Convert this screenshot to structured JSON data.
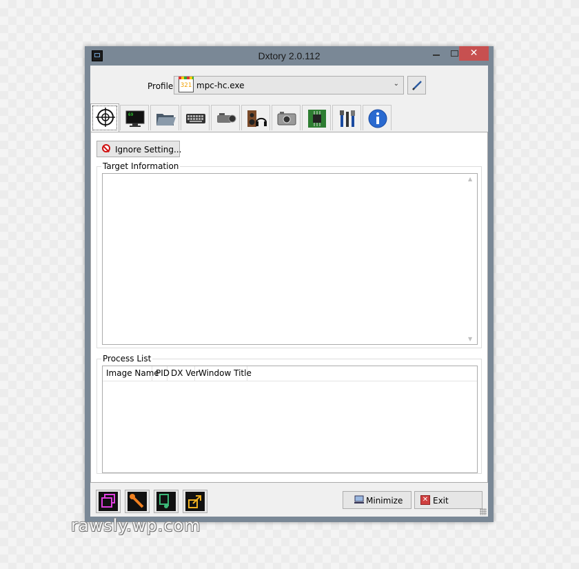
{
  "window": {
    "title": "Dxtory 2.0.112",
    "close_glyph": "✕",
    "icon": "dxtory-app-icon"
  },
  "profile": {
    "label": "Profile",
    "selected": "mpc-hc.exe",
    "selected_icon": "mpc-hc-clapper-icon",
    "edit_icon": "pencil-icon",
    "dropdown_glyph": "⌄"
  },
  "tabs": [
    {
      "name": "target",
      "icon": "crosshair-icon",
      "active": true
    },
    {
      "name": "overlay",
      "icon": "monitor-icon",
      "active": false
    },
    {
      "name": "folder",
      "icon": "folder-icon",
      "active": false
    },
    {
      "name": "hotkey",
      "icon": "keyboard-icon",
      "active": false
    },
    {
      "name": "movie",
      "icon": "video-camera-icon",
      "active": false
    },
    {
      "name": "audio",
      "icon": "speaker-headphones-icon",
      "active": false
    },
    {
      "name": "screenshot",
      "icon": "camera-icon",
      "active": false
    },
    {
      "name": "advanced",
      "icon": "chip-icon",
      "active": false
    },
    {
      "name": "tools",
      "icon": "tools-icon",
      "active": false
    },
    {
      "name": "info",
      "icon": "info-icon",
      "active": false
    }
  ],
  "target": {
    "ignore_button": "Ignore Setting...",
    "target_info_label": "Target Information",
    "process_list_label": "Process List",
    "columns": [
      "Image Name",
      "PID",
      "DX Ver",
      "Window Title"
    ]
  },
  "bottom": {
    "minimize_label": "Minimize",
    "exit_label": "Exit",
    "exit_glyph": "✕",
    "tool_icons": [
      "windows-stack-icon",
      "wrench-icon",
      "audio-file-icon",
      "export-icon"
    ]
  },
  "watermark": "rawsly.wp.com",
  "colors": {
    "titlebar": "#7a8896",
    "close_button": "#c75050",
    "client_bg": "#f0f0f0"
  }
}
